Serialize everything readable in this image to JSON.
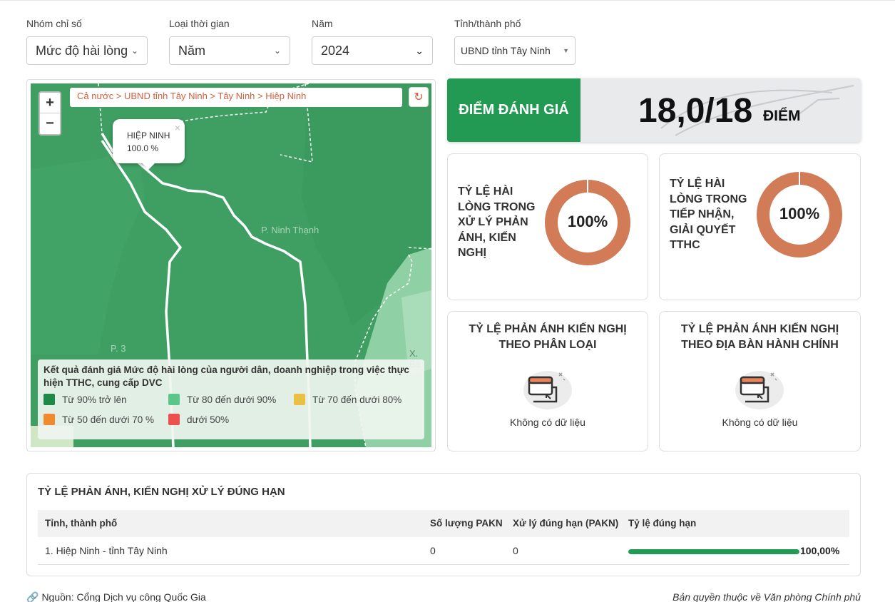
{
  "filters": [
    {
      "label": "Nhóm chỉ số",
      "value": "Mức độ hài lòng"
    },
    {
      "label": "Loại thời gian",
      "value": "Năm"
    },
    {
      "label": "Năm",
      "value": "2024"
    },
    {
      "label": "Tỉnh/thành phố",
      "value": "UBND tỉnh Tây Ninh"
    }
  ],
  "map": {
    "breadcrumb": "Cả nước > UBND tỉnh Tây Ninh > Tây Ninh > Hiệp Ninh",
    "zoom_in": "+",
    "zoom_out": "−",
    "popup": {
      "name": "HIỆP NINH",
      "value": "100.0 %"
    },
    "place_labels": {
      "ninh_thanh": "P. Ninh Thạnh",
      "p3": "P. 3",
      "x_ba": "X. Bà"
    },
    "legend": {
      "title": "Kết quả đánh giá Mức độ hài lòng của người dân, doanh nghiệp trong việc thực hiện TTHC, cung cấp DVC",
      "items": [
        {
          "label": "Từ 90% trở lên",
          "color": "#1e8a45"
        },
        {
          "label": "Từ 80 đến dưới 90%",
          "color": "#5cc68a"
        },
        {
          "label": "Từ 70 đến dưới 80%",
          "color": "#eac044"
        },
        {
          "label": "Từ 50 đến dưới 70 %",
          "color": "#f08a2c"
        },
        {
          "label": "dưới 50%",
          "color": "#ee5050"
        }
      ]
    }
  },
  "score": {
    "label": "ĐIỂM ĐÁNH GIÁ",
    "value": "18,0/18",
    "unit": "ĐIỂM"
  },
  "satisfaction": [
    {
      "title_lines": [
        "TỶ LỆ HÀI",
        "LÒNG TRONG",
        "XỬ LÝ PHẢN",
        "ÁNH, KIẾN",
        "NGHỊ"
      ],
      "percent": "100%",
      "fraction": 1.0
    },
    {
      "title_lines": [
        "TỶ LỆ HÀI",
        "LÒNG TRONG",
        "TIẾP NHẬN,",
        "GIẢI QUYẾT",
        "TTHC"
      ],
      "percent": "100%",
      "fraction": 1.0
    }
  ],
  "empty_cards": [
    {
      "title_lines": [
        "TỶ LỆ PHẢN ÁNH KIẾN NGHỊ",
        "THEO PHÂN LOẠI"
      ],
      "empty_text": "Không có dữ liệu"
    },
    {
      "title_lines": [
        "TỶ LỆ PHẢN ÁNH KIẾN NGHỊ",
        "THEO ĐỊA BÀN HÀNH CHÍNH"
      ],
      "empty_text": "Không có dữ liệu"
    }
  ],
  "table": {
    "title": "TỶ LỆ PHẢN ÁNH, KIẾN NGHỊ XỬ LÝ ĐÚNG HẠN",
    "columns": [
      "Tỉnh, thành phố",
      "Số lượng PAKN",
      "Xử lý đúng hạn (PAKN)",
      "Tỷ lệ đúng hạn"
    ],
    "rows": [
      {
        "name": "1. Hiệp Ninh - tỉnh Tây Ninh",
        "count": "0",
        "ontime": "0",
        "rate": "100,00%",
        "rate_fraction": 1.0
      }
    ]
  },
  "footer": {
    "source": "Nguồn: Cổng Dịch vụ công Quốc Gia",
    "copyright": "Bản quyền thuộc về Văn phòng Chính phủ"
  },
  "colors": {
    "accent": "#239a54",
    "donut": "#d17b57",
    "link": "#d0603f"
  }
}
